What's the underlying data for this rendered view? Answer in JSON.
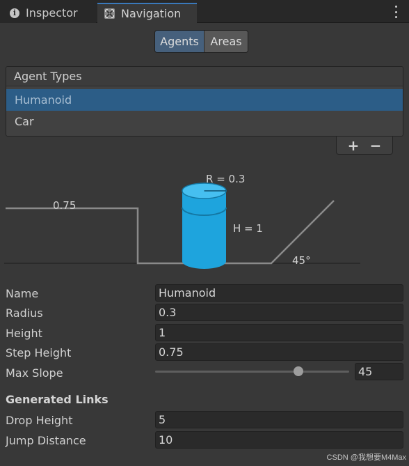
{
  "tabs": {
    "inspector": "Inspector",
    "navigation": "Navigation",
    "info_icon_glyph": "i"
  },
  "segment": {
    "agents": "Agents",
    "areas": "Areas",
    "selected": "Agents"
  },
  "agent_types": {
    "header": "Agent Types",
    "items": [
      "Humanoid",
      "Car"
    ],
    "selected_index": 0,
    "add_label": "+",
    "remove_label": "−"
  },
  "diagram": {
    "radius_label": "R = 0.3",
    "height_label": "H = 1",
    "step_label": "0.75",
    "slope_label": "45°",
    "cylinder_color": "#1ea4dd"
  },
  "fields": {
    "name": {
      "label": "Name",
      "value": "Humanoid"
    },
    "radius": {
      "label": "Radius",
      "value": "0.3"
    },
    "height": {
      "label": "Height",
      "value": "1"
    },
    "step_height": {
      "label": "Step Height",
      "value": "0.75"
    },
    "max_slope": {
      "label": "Max Slope",
      "value": "45",
      "fraction": 0.74
    }
  },
  "generated_links": {
    "title": "Generated Links",
    "drop_height": {
      "label": "Drop Height",
      "value": "5"
    },
    "jump_distance": {
      "label": "Jump Distance",
      "value": "10"
    }
  },
  "watermark": "CSDN @我想要M4Max",
  "colors": {
    "accent": "#3a79bb",
    "selection": "#2c5d87",
    "background": "#383838"
  }
}
